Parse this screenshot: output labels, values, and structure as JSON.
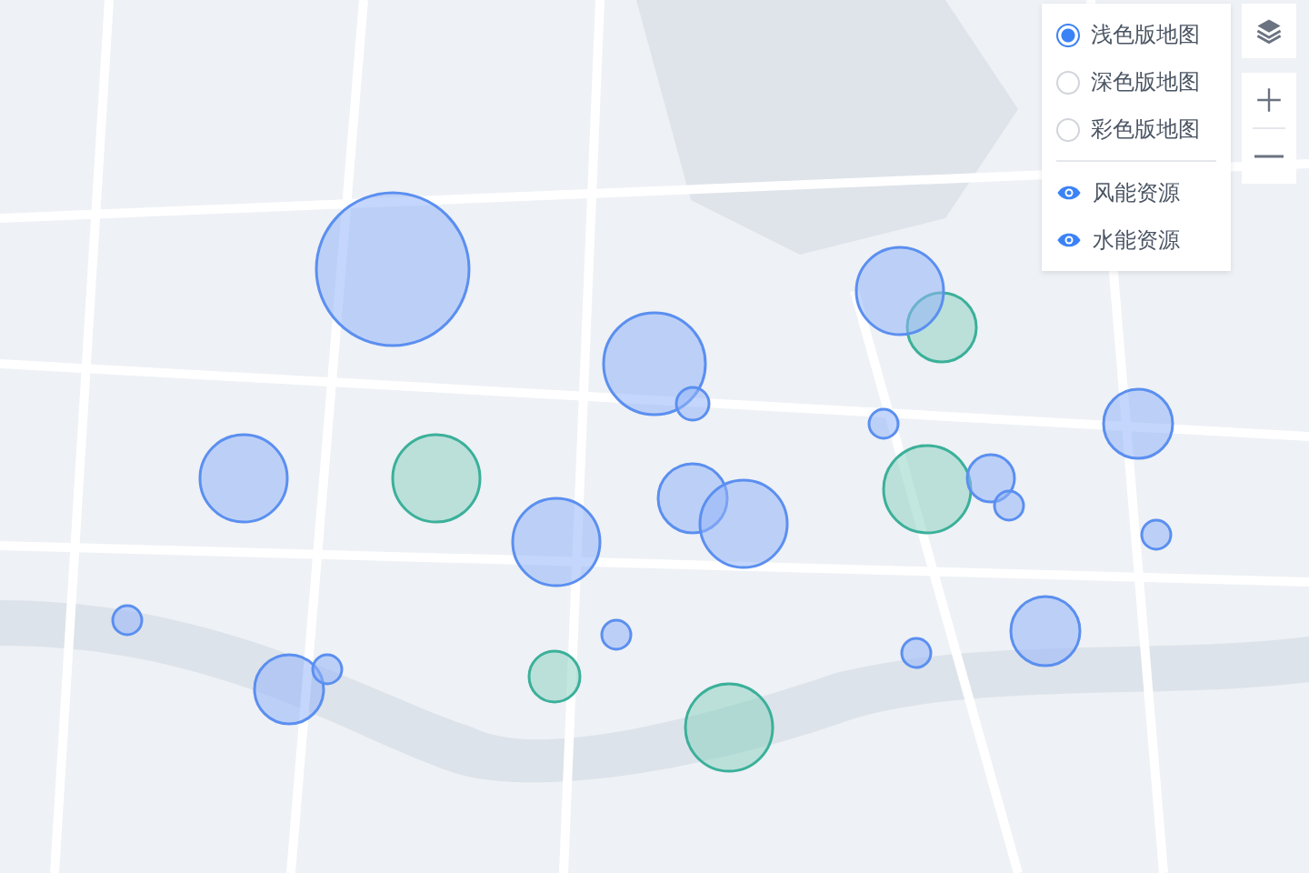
{
  "base_maps": [
    {
      "label": "浅色版地图",
      "selected": true
    },
    {
      "label": "深色版地图",
      "selected": false
    },
    {
      "label": "彩色版地图",
      "selected": false
    }
  ],
  "layers": [
    {
      "label": "风能资源",
      "visible": true
    },
    {
      "label": "水能资源",
      "visible": true
    }
  ]
}
